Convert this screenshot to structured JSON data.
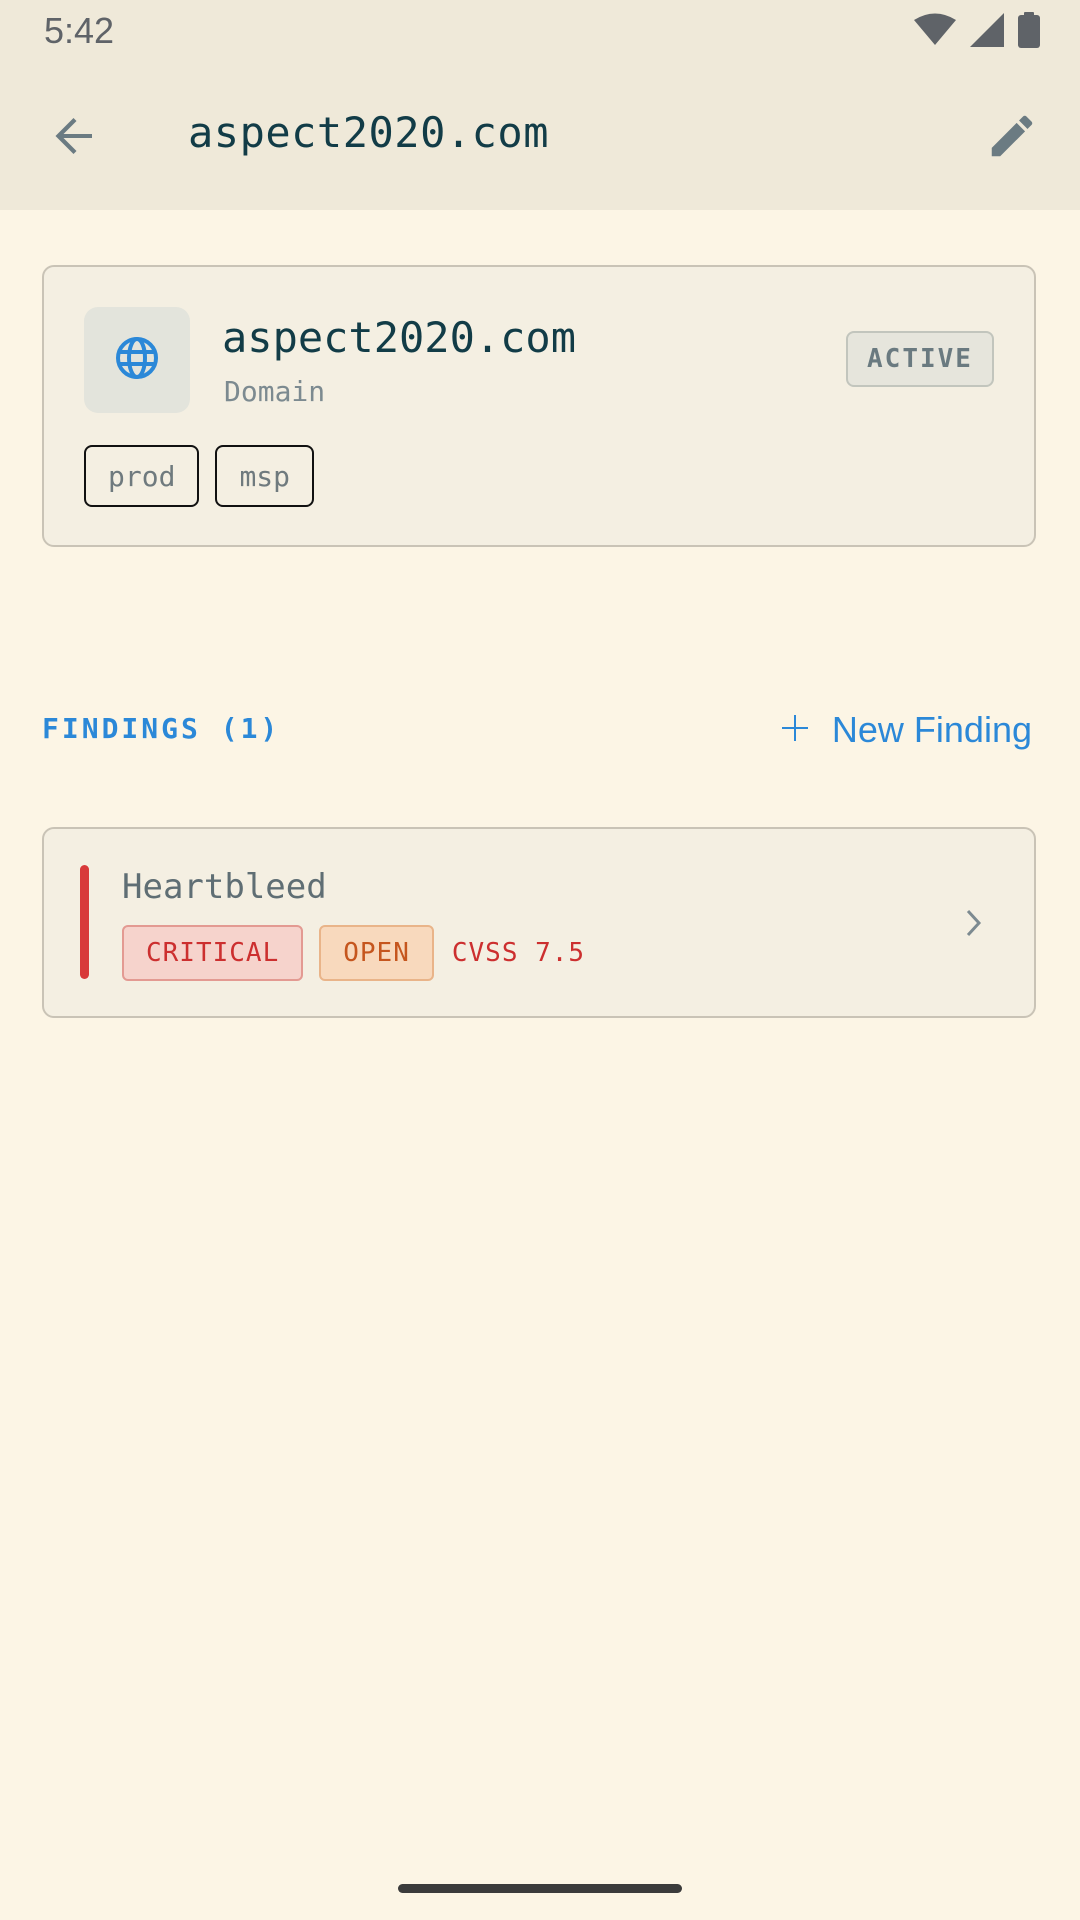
{
  "status_bar": {
    "time": "5:42",
    "icons": [
      "wifi-icon",
      "cell-signal-icon",
      "battery-icon"
    ]
  },
  "app_bar": {
    "title": "aspect2020.com",
    "back_icon": "arrow-back-icon",
    "edit_icon": "pencil-icon"
  },
  "asset": {
    "name": "aspect2020.com",
    "type": "Domain",
    "icon": "globe-icon",
    "status": "ACTIVE",
    "tags": [
      "prod",
      "msp"
    ]
  },
  "findings_section": {
    "title": "FINDINGS (1)",
    "new_button_label": "New Finding",
    "new_button_icon": "plus-icon"
  },
  "findings": [
    {
      "title": "Heartbleed",
      "severity": "CRITICAL",
      "status": "OPEN",
      "cvss": "CVSS 7.5",
      "severity_color": "#d83a3a"
    }
  ],
  "colors": {
    "accent": "#2b88d8",
    "background": "#fcf5e5",
    "critical": "#cc2f2f",
    "open": "#c5561e"
  }
}
